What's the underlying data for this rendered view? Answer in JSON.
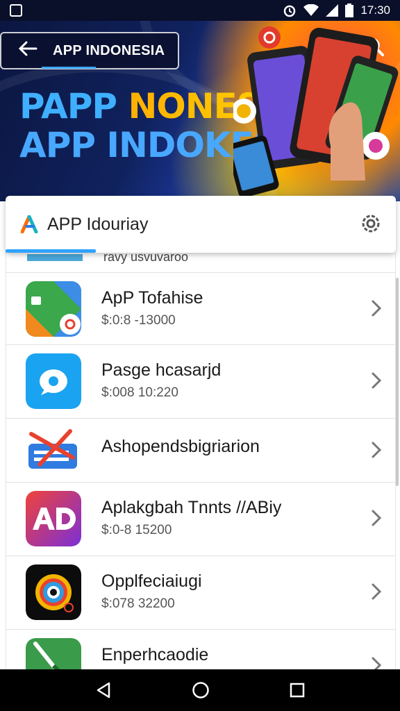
{
  "status_bar": {
    "time": "17:30"
  },
  "appbar": {
    "title": "APP INDONESIA"
  },
  "hero": {
    "line1": "PAPP NONESIA",
    "line2": "APP INDOKESIA"
  },
  "card": {
    "title": "APP Idouriay"
  },
  "list": {
    "partial_text": "ravy usvuvaroo",
    "items": [
      {
        "name": "ApP Tofahise",
        "sub": "$:0:8 -13000"
      },
      {
        "name": "Pasge hcasarjd",
        "sub": "$:008 10:220"
      },
      {
        "name": "Ashopendsbigriarion",
        "sub": ""
      },
      {
        "name": "Aplakgbah Tnnts //ABiy",
        "sub": "$:0-8 15200"
      },
      {
        "name": "Opplfeciaiugi",
        "sub": "$:078 32200"
      },
      {
        "name": "Enperhcaodie",
        "sub": ""
      }
    ]
  },
  "colors": {
    "accent": "#2fa3ff",
    "status_bg": "#0a0f2a",
    "nav_bg": "#000000"
  }
}
